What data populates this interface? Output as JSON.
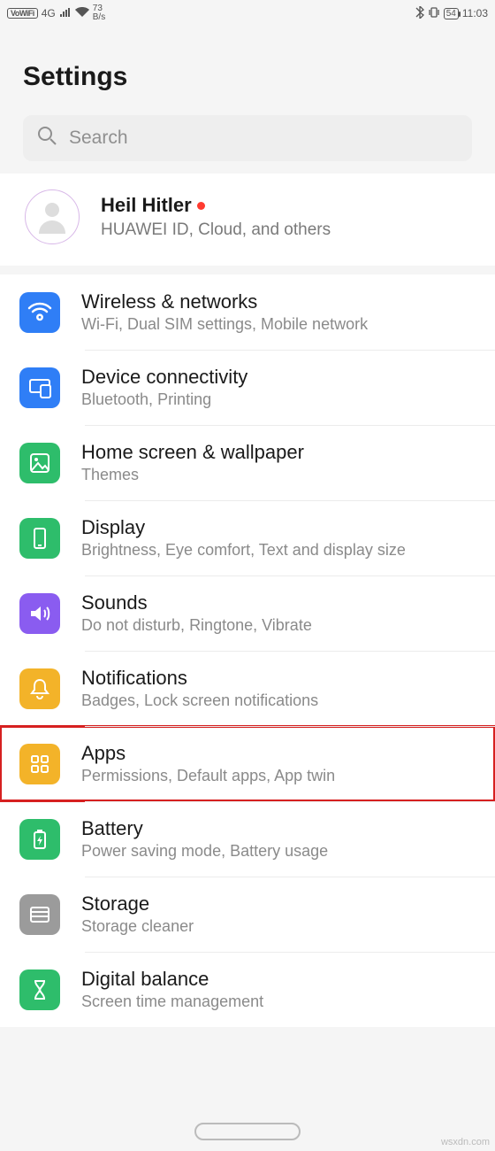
{
  "statusbar": {
    "vowifi": "VoWiFi",
    "net": "4G",
    "speed_top": "73",
    "speed_bot": "B/s",
    "battery": "54",
    "time": "11:03"
  },
  "title": "Settings",
  "search": {
    "placeholder": "Search"
  },
  "account": {
    "name": "Heil Hitler",
    "sub": "HUAWEI ID, Cloud, and others"
  },
  "items": [
    {
      "icon": "wifi-icon",
      "color": "#2f7ef6",
      "title": "Wireless & networks",
      "sub": "Wi-Fi, Dual SIM settings, Mobile network"
    },
    {
      "icon": "devices-icon",
      "color": "#2f7ef6",
      "title": "Device connectivity",
      "sub": "Bluetooth, Printing"
    },
    {
      "icon": "image-icon",
      "color": "#2ebd6b",
      "title": "Home screen & wallpaper",
      "sub": "Themes"
    },
    {
      "icon": "phone-icon",
      "color": "#2ebd6b",
      "title": "Display",
      "sub": "Brightness, Eye comfort, Text and display size"
    },
    {
      "icon": "speaker-icon",
      "color": "#8a5cf0",
      "title": "Sounds",
      "sub": "Do not disturb, Ringtone, Vibrate"
    },
    {
      "icon": "bell-icon",
      "color": "#f3b329",
      "title": "Notifications",
      "sub": "Badges, Lock screen notifications"
    },
    {
      "icon": "grid-icon",
      "color": "#f3b329",
      "title": "Apps",
      "sub": "Permissions, Default apps, App twin",
      "highlighted": true
    },
    {
      "icon": "battery-icon",
      "color": "#2ebd6b",
      "title": "Battery",
      "sub": "Power saving mode, Battery usage"
    },
    {
      "icon": "storage-icon",
      "color": "#9b9b9b",
      "title": "Storage",
      "sub": "Storage cleaner"
    },
    {
      "icon": "hourglass-icon",
      "color": "#2ebd6b",
      "title": "Digital balance",
      "sub": "Screen time management"
    }
  ],
  "watermark": "wsxdn.com"
}
